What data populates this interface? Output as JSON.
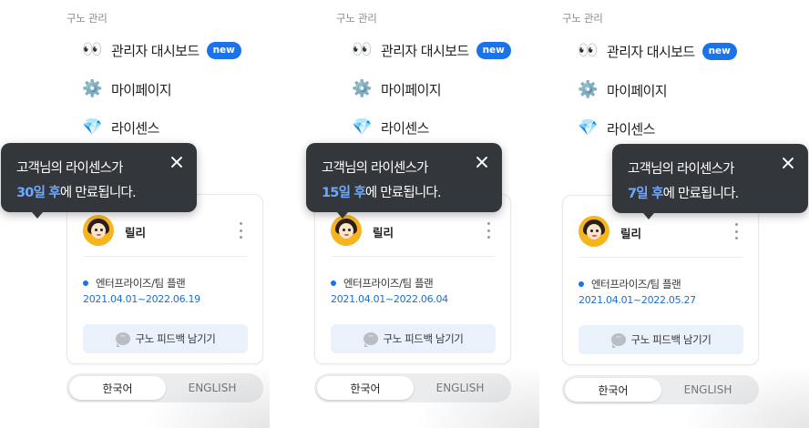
{
  "panels": [
    {
      "section_title": "구노 관리",
      "menu": [
        {
          "icon": "👀",
          "label": "관리자 대시보드",
          "badge": "new"
        },
        {
          "icon": "⚙️",
          "label": "마이페이지"
        },
        {
          "icon": "💎",
          "label": "라이센스"
        }
      ],
      "tooltip": {
        "line1": "고객님의 라이센스가",
        "days": "30일 후",
        "line2_rest": "에 만료됩니다."
      },
      "user": {
        "name": "릴리"
      },
      "plan": {
        "name": "엔터프라이즈/팀 플랜",
        "period": "2021.04.01~2022.06.19"
      },
      "feedback_label": "구노 피드백 남기기",
      "lang": {
        "ko": "한국어",
        "en": "ENGLISH",
        "selected": "ko"
      }
    },
    {
      "section_title": "구노 관리",
      "menu": [
        {
          "icon": "👀",
          "label": "관리자 대시보드",
          "badge": "new"
        },
        {
          "icon": "⚙️",
          "label": "마이페이지"
        },
        {
          "icon": "💎",
          "label": "라이센스"
        }
      ],
      "tooltip": {
        "line1": "고객님의 라이센스가",
        "days": "15일 후",
        "line2_rest": "에 만료됩니다."
      },
      "user": {
        "name": "릴리"
      },
      "plan": {
        "name": "엔터프라이즈/팀 플랜",
        "period": "2021.04.01~2022.06.04"
      },
      "feedback_label": "구노 피드백 남기기",
      "lang": {
        "ko": "한국어",
        "en": "ENGLISH",
        "selected": "ko"
      }
    },
    {
      "section_title": "구노 관리",
      "menu": [
        {
          "icon": "👀",
          "label": "관리자 대시보드",
          "badge": "new"
        },
        {
          "icon": "⚙️",
          "label": "마이페이지"
        },
        {
          "icon": "💎",
          "label": "라이센스"
        }
      ],
      "tooltip": {
        "line1": "고객님의 라이센스가",
        "days": "7일 후",
        "line2_rest": "에 만료됩니다."
      },
      "user": {
        "name": "릴리"
      },
      "plan": {
        "name": "엔터프라이즈/팀 플랜",
        "period": "2021.04.01~2022.05.27"
      },
      "feedback_label": "구노 피드백 남기기",
      "lang": {
        "ko": "한국어",
        "en": "ENGLISH",
        "selected": "ko"
      }
    }
  ],
  "colors": {
    "accent": "#1a73e8",
    "tooltip_bg": "#33363b",
    "tooltip_highlight": "#6ea8ff"
  }
}
